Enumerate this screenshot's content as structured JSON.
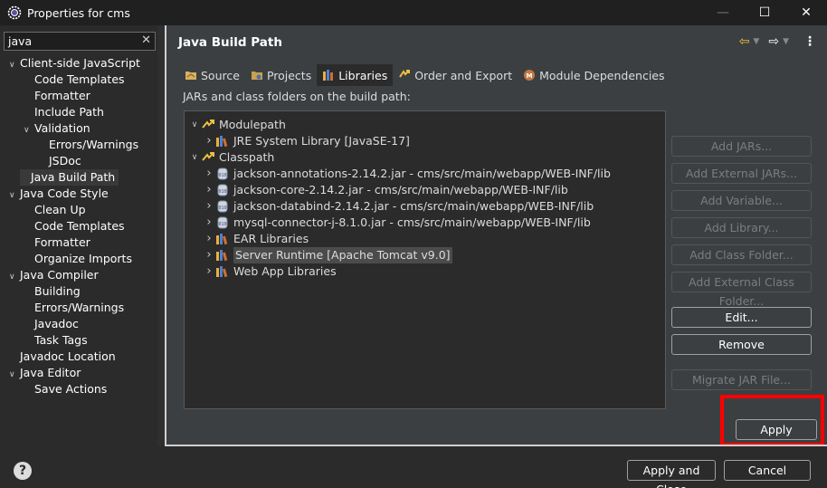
{
  "window": {
    "title": "Properties for cms",
    "minimize": "—",
    "maximize": "☐",
    "close": "✕"
  },
  "filter": {
    "value": "java",
    "clear": "✕"
  },
  "nav_tree": [
    {
      "label": "Client-side JavaScript",
      "level": 0,
      "expanded": true
    },
    {
      "label": "Code Templates",
      "level": 1
    },
    {
      "label": "Formatter",
      "level": 1
    },
    {
      "label": "Include Path",
      "level": 1
    },
    {
      "label": "Validation",
      "level": 1,
      "expanded": true
    },
    {
      "label": "Errors/Warnings",
      "level": 2
    },
    {
      "label": "JSDoc",
      "level": 2
    },
    {
      "label": "Java Build Path",
      "level": 0,
      "selected": true
    },
    {
      "label": "Java Code Style",
      "level": 0,
      "expanded": true
    },
    {
      "label": "Clean Up",
      "level": 1
    },
    {
      "label": "Code Templates",
      "level": 1
    },
    {
      "label": "Formatter",
      "level": 1
    },
    {
      "label": "Organize Imports",
      "level": 1
    },
    {
      "label": "Java Compiler",
      "level": 0,
      "expanded": true
    },
    {
      "label": "Building",
      "level": 1
    },
    {
      "label": "Errors/Warnings",
      "level": 1
    },
    {
      "label": "Javadoc",
      "level": 1
    },
    {
      "label": "Task Tags",
      "level": 1
    },
    {
      "label": "Javadoc Location",
      "level": 0
    },
    {
      "label": "Java Editor",
      "level": 0,
      "expanded": true
    },
    {
      "label": "Save Actions",
      "level": 1
    }
  ],
  "page": {
    "title": "Java Build Path",
    "tabs": [
      {
        "label": "Source",
        "icon": "source-folder-icon"
      },
      {
        "label": "Projects",
        "icon": "projects-icon"
      },
      {
        "label": "Libraries",
        "icon": "libraries-icon",
        "active": true
      },
      {
        "label": "Order and Export",
        "icon": "order-export-icon"
      },
      {
        "label": "Module Dependencies",
        "icon": "module-icon"
      }
    ],
    "jars_label": "JARs and class folders on the build path:"
  },
  "build_tree": [
    {
      "label": "Modulepath",
      "level": 0,
      "expanded": true,
      "icon": "path-icon"
    },
    {
      "label": "JRE System Library [JavaSE-17]",
      "level": 1,
      "icon": "library-icon"
    },
    {
      "label": "Classpath",
      "level": 0,
      "expanded": true,
      "icon": "path-icon"
    },
    {
      "label": "jackson-annotations-2.14.2.jar - cms/src/main/webapp/WEB-INF/lib",
      "level": 1,
      "icon": "jar-icon"
    },
    {
      "label": "jackson-core-2.14.2.jar - cms/src/main/webapp/WEB-INF/lib",
      "level": 1,
      "icon": "jar-icon"
    },
    {
      "label": "jackson-databind-2.14.2.jar - cms/src/main/webapp/WEB-INF/lib",
      "level": 1,
      "icon": "jar-icon"
    },
    {
      "label": "mysql-connector-j-8.1.0.jar - cms/src/main/webapp/WEB-INF/lib",
      "level": 1,
      "icon": "jar-icon"
    },
    {
      "label": "EAR Libraries",
      "level": 1,
      "icon": "library-icon"
    },
    {
      "label": "Server Runtime [Apache Tomcat v9.0]",
      "level": 1,
      "icon": "library-icon",
      "selected": true
    },
    {
      "label": "Web App Libraries",
      "level": 1,
      "icon": "library-icon"
    }
  ],
  "buttons": {
    "add_jars": "Add JARs...",
    "add_external_jars": "Add External JARs...",
    "add_variable": "Add Variable...",
    "add_library": "Add Library...",
    "add_class_folder": "Add Class Folder...",
    "add_external_class_folder": "Add External Class Folder...",
    "edit": "Edit...",
    "remove": "Remove",
    "migrate_jar": "Migrate JAR File..."
  },
  "apply": "Apply",
  "footer": {
    "help": "?",
    "apply_close": "Apply and Close",
    "cancel": "Cancel"
  },
  "colors": {
    "highlight": "#ff0000",
    "background": "#2b2b2b",
    "panel": "#3c3f41"
  }
}
